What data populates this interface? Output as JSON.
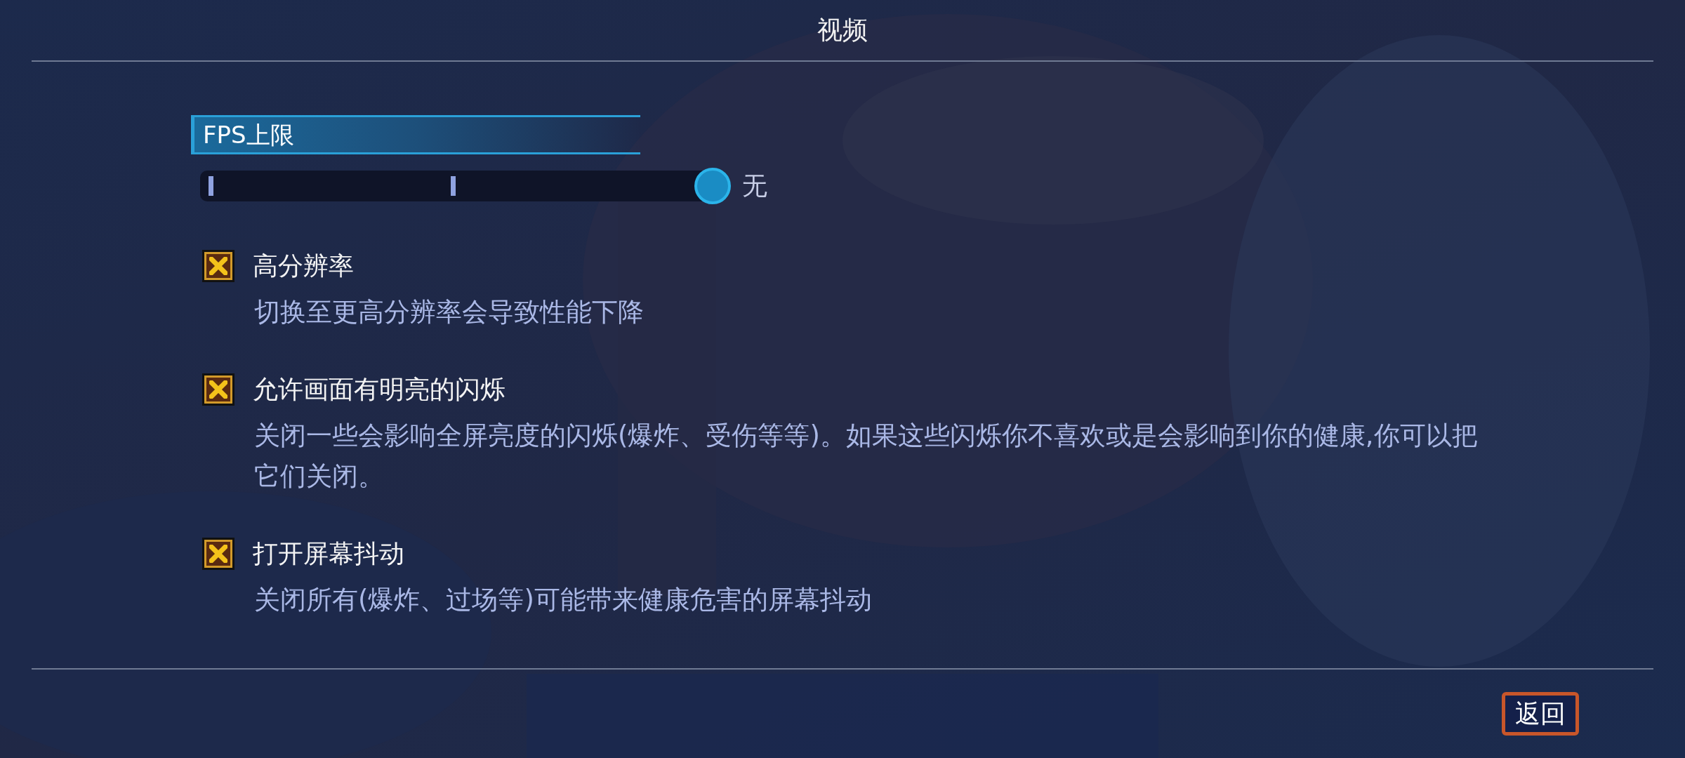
{
  "header": {
    "title": "视频"
  },
  "fps_limit": {
    "label": "FPS上限",
    "level": 1,
    "reading": "无"
  },
  "options": [
    {
      "label": "高分辨率",
      "checked": true,
      "description": "切换至更高分辨率会导致性能下降"
    },
    {
      "label": "允许画面有明亮的闪烁",
      "checked": true,
      "description": "关闭一些会影响全屏亮度的闪烁(爆炸、受伤等等)。如果这些闪烁你不喜欢或是会影响到你的健康,你可以把它们关闭。"
    },
    {
      "label": "打开屏幕抖动",
      "checked": true,
      "description": "关闭所有(爆炸、过场等)可能带来健康危害的屏幕抖动"
    }
  ],
  "footer": {
    "back_button": "返回"
  }
}
